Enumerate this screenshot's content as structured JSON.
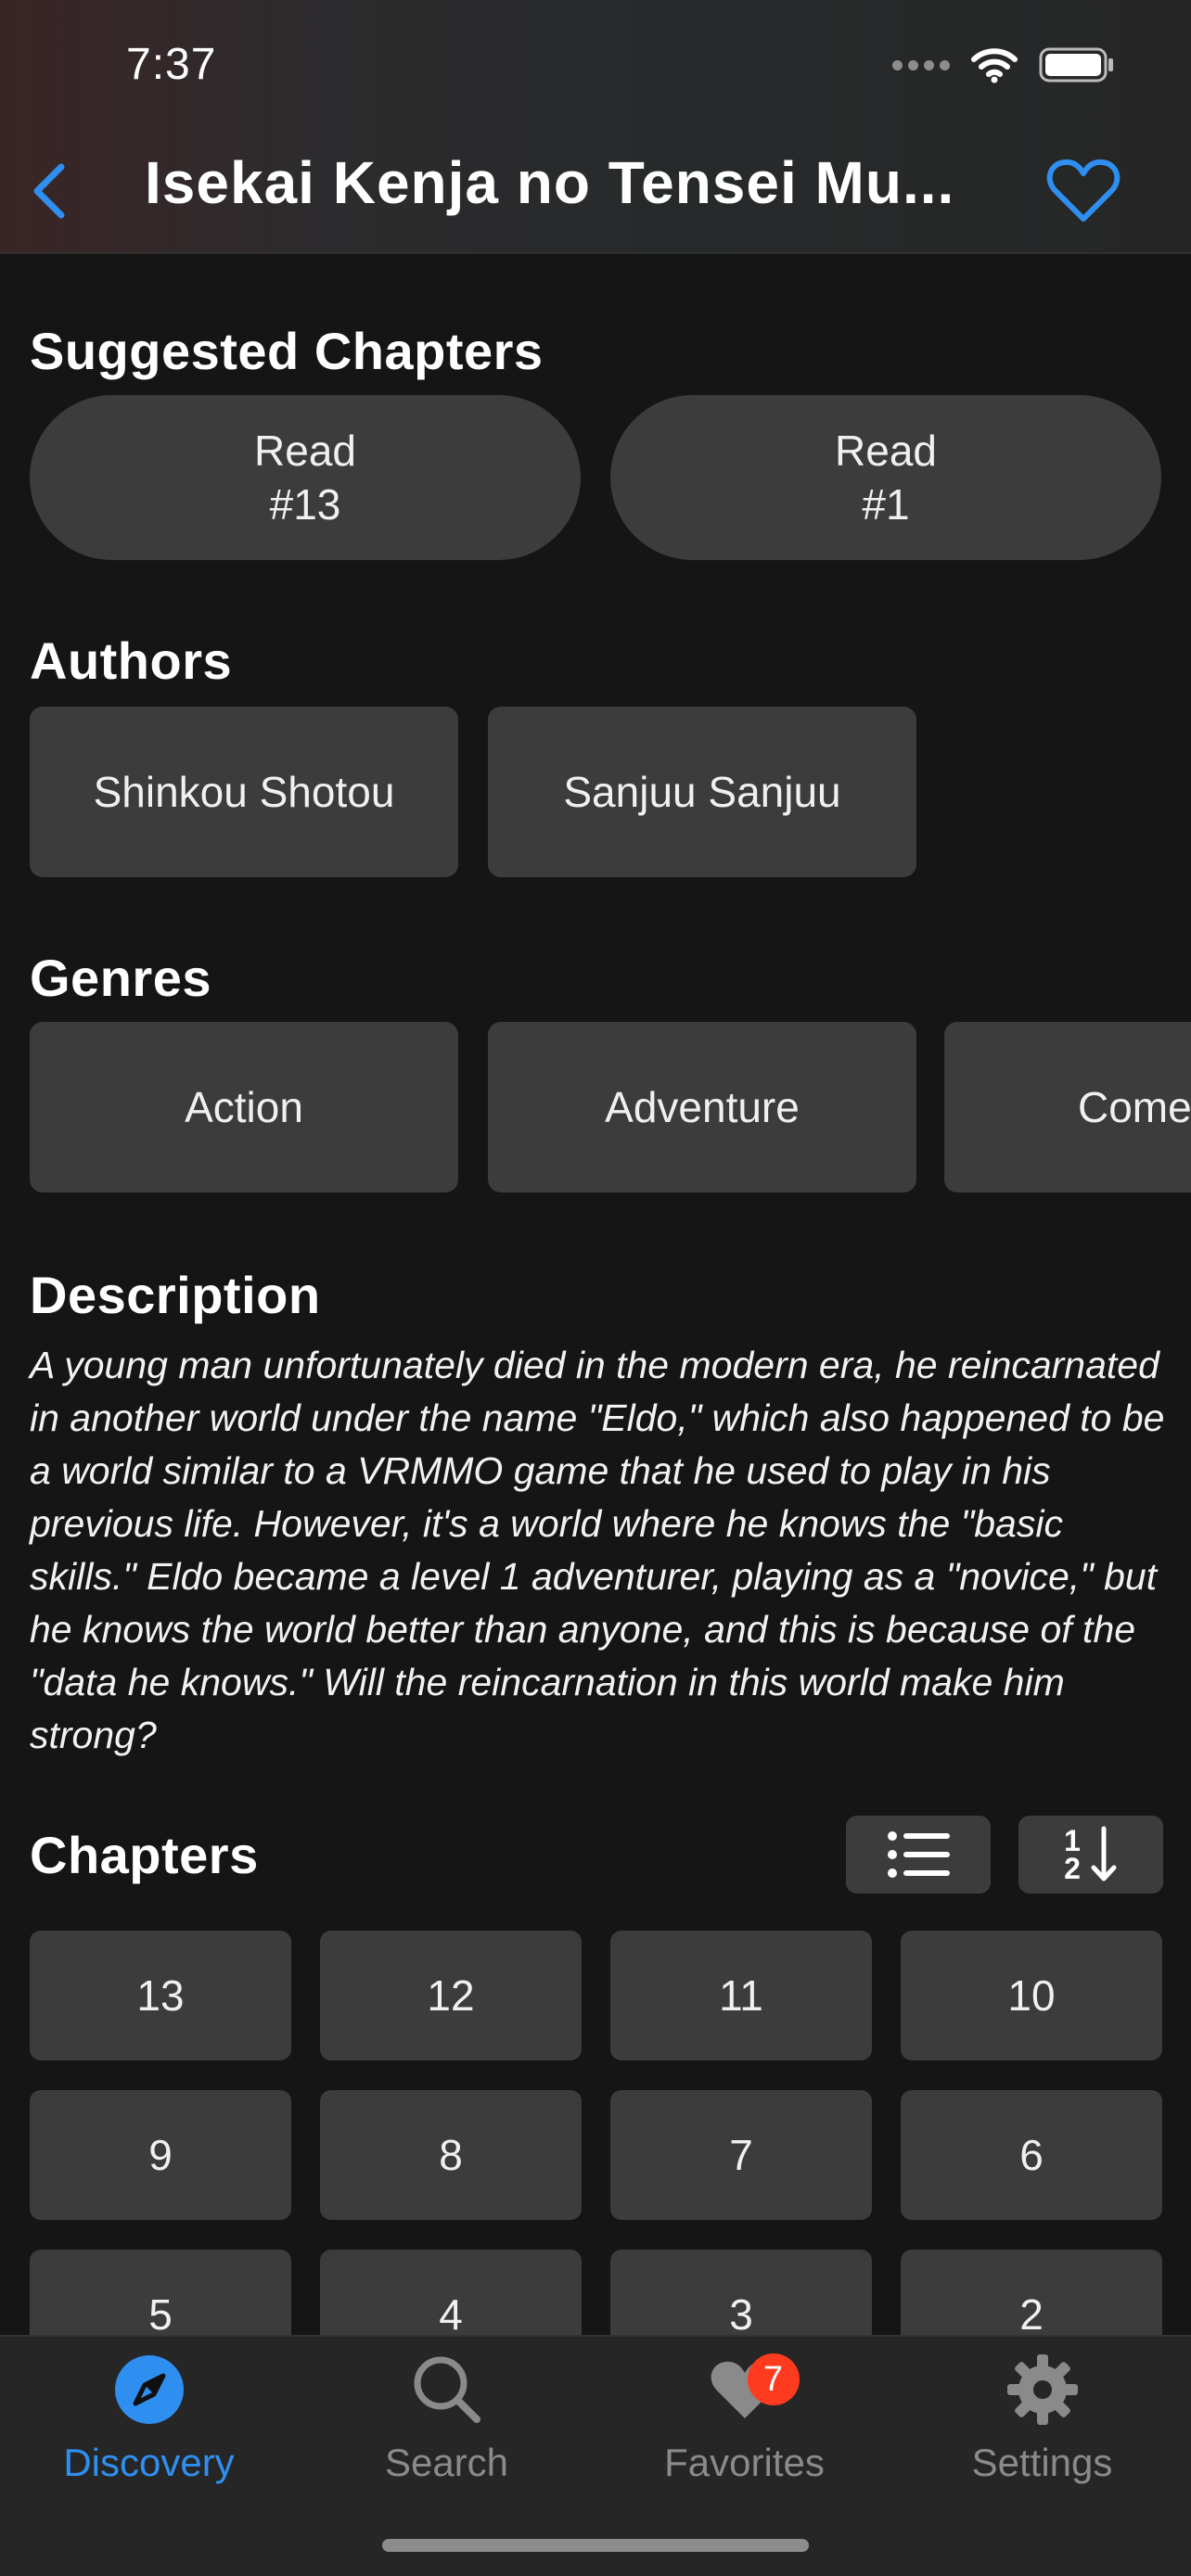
{
  "status_bar": {
    "time": "7:37"
  },
  "header": {
    "title": "Isekai Kenja no Tensei Mu..."
  },
  "suggested": {
    "title": "Suggested Chapters",
    "buttons": [
      {
        "line1": "Read",
        "line2": "#13"
      },
      {
        "line1": "Read",
        "line2": "#1"
      }
    ]
  },
  "authors": {
    "title": "Authors",
    "items": [
      "Shinkou Shotou",
      "Sanjuu Sanjuu"
    ]
  },
  "genres": {
    "title": "Genres",
    "items": [
      "Action",
      "Adventure",
      "Come"
    ]
  },
  "description": {
    "title": "Description",
    "text": "A young man unfortunately died in the modern era, he reincarnated in another world under the name \"Eldo,\" which also happened to be a world similar to a VRMMO game that he used to play in his previous life. However, it's a world where he knows the \"basic skills.\" Eldo became a level 1 adventurer, playing as a \"novice,\" but he knows the world better than anyone, and this is because of the \"data he knows.\" Will the reincarnation in this world make him strong?"
  },
  "chapters": {
    "title": "Chapters",
    "sort_digits": [
      "1",
      "2"
    ],
    "items": [
      "13",
      "12",
      "11",
      "10",
      "9",
      "8",
      "7",
      "6",
      "5",
      "4",
      "3",
      "2"
    ]
  },
  "tabbar": {
    "tabs": [
      {
        "label": "Discovery",
        "icon": "compass-icon",
        "active": true
      },
      {
        "label": "Search",
        "icon": "search-icon"
      },
      {
        "label": "Favorites",
        "icon": "heart-icon",
        "badge": "7"
      },
      {
        "label": "Settings",
        "icon": "gear-icon"
      }
    ]
  },
  "colors": {
    "accent": "#2f8ff0",
    "badge": "#ff3b1f",
    "button": "#3c3c3c",
    "background": "#151515"
  }
}
